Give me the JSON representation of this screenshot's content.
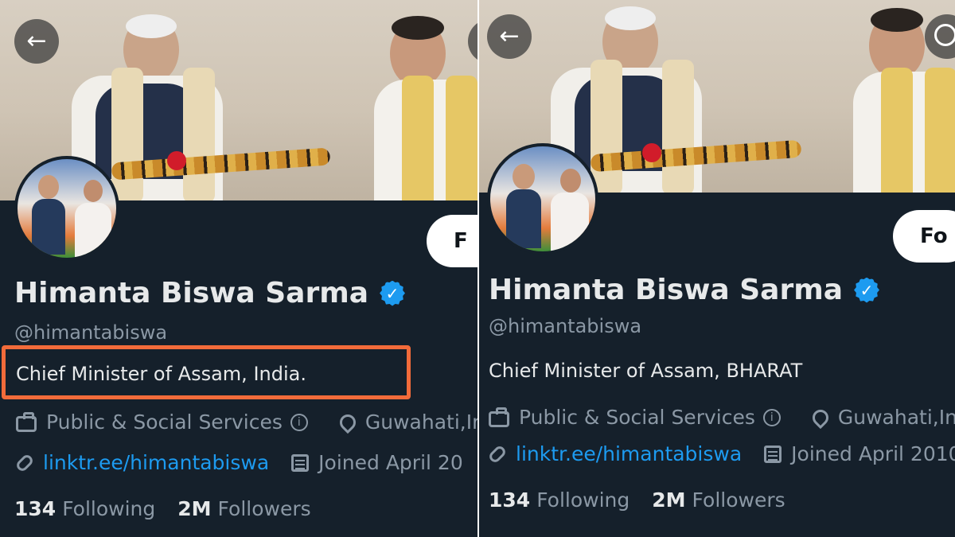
{
  "left": {
    "name": "Himanta Biswa Sarma",
    "handle": "@himantabiswa",
    "bio": "Chief Minister of Assam, India.",
    "category": "Public & Social Services",
    "location": "Guwahati,In",
    "link": "linktr.ee/himantabiswa",
    "joined": "Joined April 20",
    "following_count": "134",
    "following_label": "Following",
    "followers_count": "2M",
    "followers_label": "Followers",
    "follow_button": "F",
    "info_glyph": "i",
    "back_glyph": "←"
  },
  "right": {
    "name": "Himanta Biswa Sarma",
    "handle": "@himantabiswa",
    "bio": "Chief Minister of Assam, BHARAT",
    "category": "Public & Social Services",
    "location": "Guwahati,Inc",
    "link": "linktr.ee/himantabiswa",
    "joined": "Joined April 2010",
    "following_count": "134",
    "following_label": "Following",
    "followers_count": "2M",
    "followers_label": "Followers",
    "follow_button": "Fo",
    "info_glyph": "i",
    "back_glyph": "←"
  },
  "colors": {
    "background": "#15202b",
    "verified": "#1d9bf0",
    "link": "#1d9bf0",
    "highlight": "#f26b3a"
  },
  "icons": [
    "back-arrow-icon",
    "search-icon",
    "verified-badge-icon",
    "briefcase-icon",
    "info-icon",
    "location-pin-icon",
    "link-icon",
    "calendar-icon"
  ]
}
